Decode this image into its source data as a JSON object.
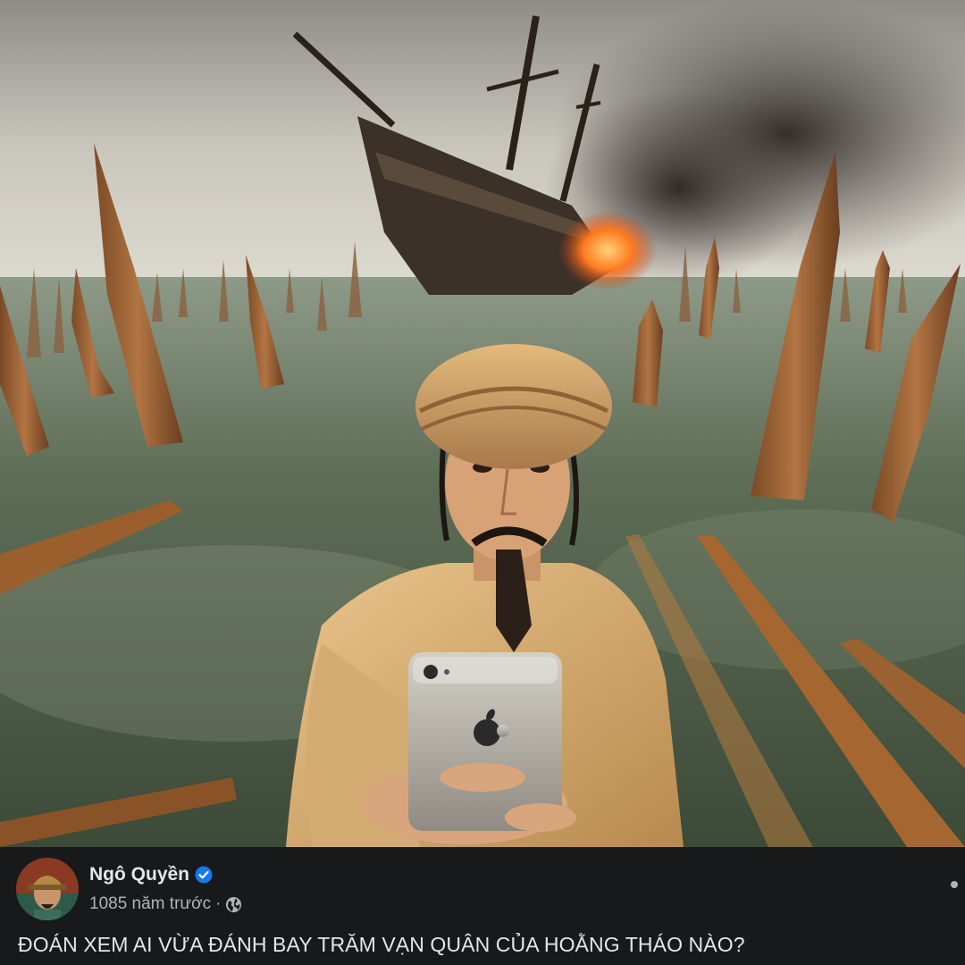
{
  "post": {
    "author_name": "Ngô Quyền",
    "verified": true,
    "timestamp": "1085 năm trước",
    "separator": "·",
    "privacy_icon": "globe-icon",
    "caption": "ĐOÁN XEM AI VỪA ĐÁNH BAY TRĂM VẠN QUÂN CỦA HOẰNG THÁO NÀO?"
  },
  "colors": {
    "background": "#18191a",
    "text_primary": "#e4e6eb",
    "text_secondary": "#b0b3b8",
    "verified_badge": "#1877f2"
  }
}
